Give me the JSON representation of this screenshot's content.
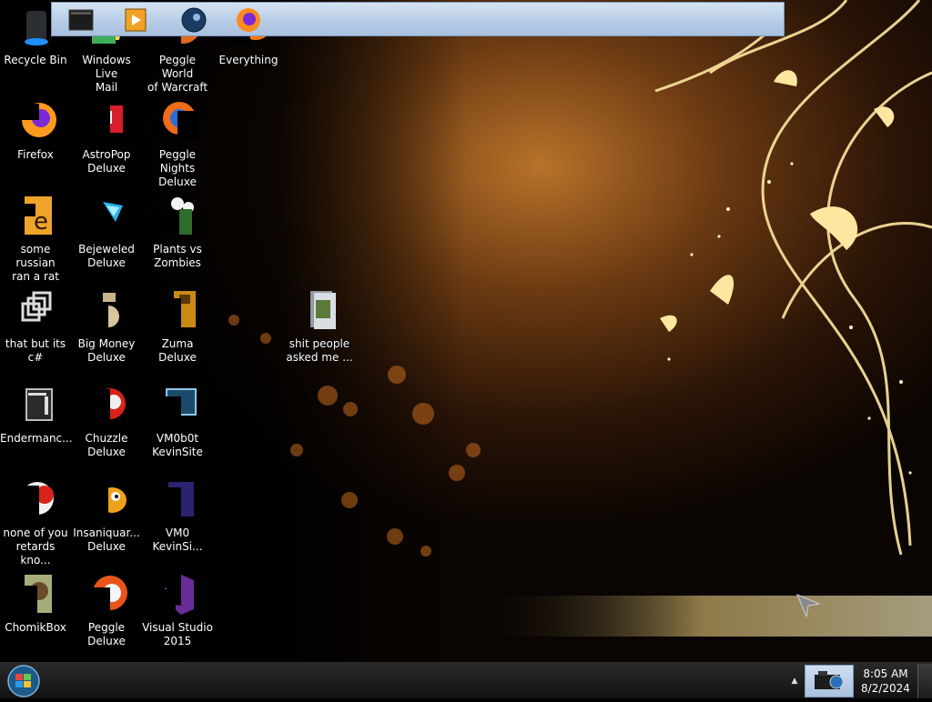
{
  "desktop_icons": [
    {
      "label": "Recycle Bin",
      "icon": "recycle-bin-icon"
    },
    {
      "label": "Windows Live\nMail",
      "icon": "windows-live-mail-icon"
    },
    {
      "label": "Peggle World\nof Warcraft ...",
      "icon": "peggle-world-of-warcraft-icon"
    },
    {
      "label": "Everything",
      "icon": "everything-search-icon"
    },
    {
      "label": "Firefox",
      "icon": "firefox-icon"
    },
    {
      "label": "AstroPop\nDeluxe",
      "icon": "astropop-deluxe-icon"
    },
    {
      "label": "Peggle Nights\nDeluxe",
      "icon": "peggle-nights-deluxe-icon"
    },
    {
      "label": "some russian\nran a rat",
      "icon": "java-archive-icon"
    },
    {
      "label": "Bejeweled\nDeluxe",
      "icon": "bejeweled-deluxe-icon"
    },
    {
      "label": "Plants vs\nZombies",
      "icon": "plants-vs-zombies-icon"
    },
    {
      "label": "that but its c#",
      "icon": "shortcut-stack-icon"
    },
    {
      "label": "Big Money\nDeluxe",
      "icon": "big-money-deluxe-icon"
    },
    {
      "label": "Zuma Deluxe",
      "icon": "zuma-deluxe-icon"
    },
    {
      "label": "shit people\nasked me ...",
      "icon": "folder-icon"
    },
    {
      "label": "Endermanc...",
      "icon": "application-window-icon"
    },
    {
      "label": "Chuzzle\nDeluxe",
      "icon": "chuzzle-deluxe-icon"
    },
    {
      "label": "VM0b0t\nKevinSite",
      "icon": "vm0b0t-kevinsite-icon"
    },
    {
      "label": "none of you\nretards kno...",
      "icon": "generic-app-icon"
    },
    {
      "label": "Insaniquar...\nDeluxe",
      "icon": "insaniquarium-deluxe-icon"
    },
    {
      "label": "VM0\nKevinSi...",
      "icon": "vm0-kevinsite-icon"
    },
    {
      "label": "ChomikBox",
      "icon": "chomikbox-icon"
    },
    {
      "label": "Peggle Deluxe",
      "icon": "peggle-deluxe-icon"
    },
    {
      "label": "Visual Studio\n2015",
      "icon": "visual-studio-2015-icon"
    }
  ],
  "taskbar": {
    "start_button": "windows-start-orb-icon",
    "pinned": [
      {
        "icon": "terminal-app-icon"
      },
      {
        "icon": "windows-media-player-icon"
      },
      {
        "icon": "steam-like-app-icon"
      },
      {
        "icon": "firefox-icon"
      }
    ],
    "tray_show_hidden": "tray-up-arrow-icon",
    "tray_app": "webcam-app-icon"
  },
  "clock": {
    "time": "8:05 AM",
    "date": "8/2/2024"
  },
  "colors": {
    "taskbar_band": "#b7cde6",
    "wallpaper_gold": "#e8a93a"
  }
}
